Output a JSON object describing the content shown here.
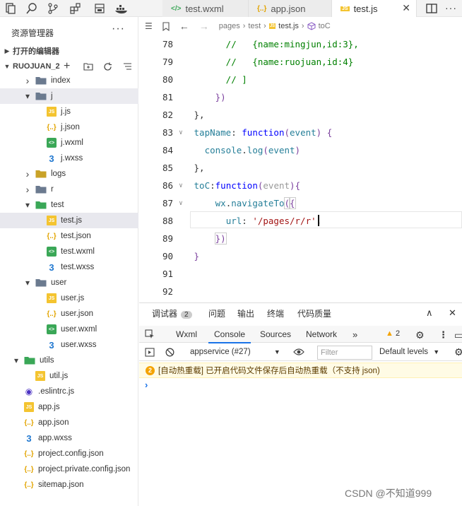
{
  "tabs": [
    {
      "label": "test.wxml",
      "icon": "wxml-icon"
    },
    {
      "label": "app.json",
      "icon": "json-icon"
    },
    {
      "label": "test.js",
      "icon": "js-icon",
      "active": true
    }
  ],
  "sidebar": {
    "title": "资源管理器",
    "more": "···",
    "open_editors": "打开的编辑器",
    "project": "RUOJUAN_2",
    "tree": [
      {
        "label": "index",
        "type": "folder",
        "level": 1,
        "expanded": false
      },
      {
        "label": "j",
        "type": "folder",
        "level": 1,
        "expanded": true
      },
      {
        "label": "j.js",
        "type": "js",
        "level": 2
      },
      {
        "label": "j.json",
        "type": "json",
        "level": 2
      },
      {
        "label": "j.wxml",
        "type": "wxml",
        "level": 2
      },
      {
        "label": "j.wxss",
        "type": "wxss",
        "level": 2
      },
      {
        "label": "logs",
        "type": "folder",
        "level": 1,
        "expanded": false
      },
      {
        "label": "r",
        "type": "folder",
        "level": 1,
        "expanded": false
      },
      {
        "label": "test",
        "type": "folder",
        "level": 1,
        "expanded": true
      },
      {
        "label": "test.js",
        "type": "js",
        "level": 2
      },
      {
        "label": "test.json",
        "type": "json",
        "level": 2
      },
      {
        "label": "test.wxml",
        "type": "wxml",
        "level": 2
      },
      {
        "label": "test.wxss",
        "type": "wxss",
        "level": 2
      },
      {
        "label": "user",
        "type": "folder",
        "level": 1,
        "expanded": true
      },
      {
        "label": "user.js",
        "type": "js",
        "level": 2
      },
      {
        "label": "user.json",
        "type": "json",
        "level": 2
      },
      {
        "label": "user.wxml",
        "type": "wxml",
        "level": 2
      },
      {
        "label": "user.wxss",
        "type": "wxss",
        "level": 2
      },
      {
        "label": "utils",
        "type": "folder",
        "level": 0,
        "expanded": true
      },
      {
        "label": "util.js",
        "type": "js",
        "level": 1
      },
      {
        "label": ".eslintrc.js",
        "type": "eslint",
        "level": 0
      },
      {
        "label": "app.js",
        "type": "js",
        "level": 0
      },
      {
        "label": "app.json",
        "type": "json",
        "level": 0
      },
      {
        "label": "app.wxss",
        "type": "wxss",
        "level": 0
      },
      {
        "label": "project.config.json",
        "type": "json",
        "level": 0
      },
      {
        "label": "project.private.config.json",
        "type": "json",
        "level": 0
      },
      {
        "label": "sitemap.json",
        "type": "json",
        "level": 0
      }
    ]
  },
  "breadcrumb": [
    "pages",
    "test",
    "test.js",
    "toC"
  ],
  "editor": {
    "line_numbers": [
      "78",
      "79",
      "80",
      "81",
      "82",
      "83",
      "84",
      "85",
      "86",
      "87",
      "88",
      "89",
      "90",
      "91",
      "92"
    ]
  },
  "panel": {
    "tab_debugger": "调试器",
    "badge": "2",
    "tab_issues": "问题",
    "tab_output": "输出",
    "tab_terminal": "终端",
    "tab_quality": "代码质量",
    "subtabs": [
      "Wxml",
      "Console",
      "Sources",
      "Network"
    ],
    "more": "»",
    "warn_count": "2",
    "context": "appservice (#27)",
    "filter_placeholder": "Filter",
    "levels": "Default levels",
    "message_badge": "2",
    "message": "[自动热重载] 已开启代码文件保存后自动热重载（不支持 json)"
  },
  "watermark": "CSDN @不知道999"
}
